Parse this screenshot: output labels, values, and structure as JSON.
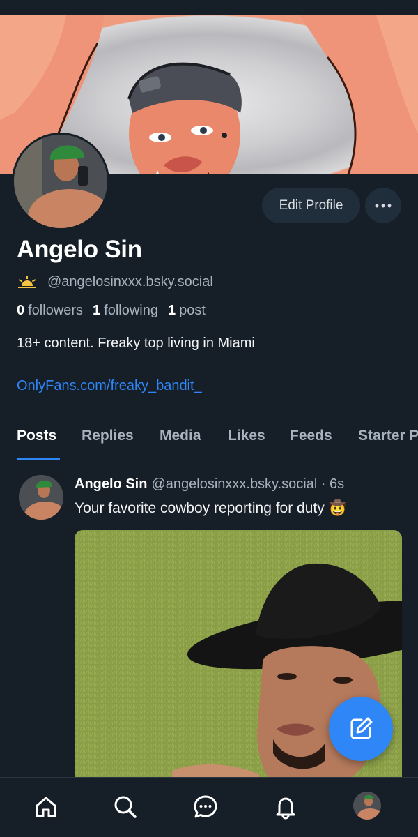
{
  "profile": {
    "display_name": "Angelo Sin",
    "handle": "@angelosinxxx.bsky.social",
    "handle_icon": "sunrise-icon",
    "stats": {
      "followers_count": "0",
      "followers_label": "followers",
      "following_count": "1",
      "following_label": "following",
      "posts_count": "1",
      "posts_label": "post"
    },
    "bio": "18+ content. Freaky top living in Miami",
    "link": "OnlyFans.com/freaky_bandit_"
  },
  "actions": {
    "edit_profile_label": "Edit Profile",
    "more_icon": "ellipsis-icon"
  },
  "tabs": [
    {
      "label": "Posts",
      "active": true
    },
    {
      "label": "Replies",
      "active": false
    },
    {
      "label": "Media",
      "active": false
    },
    {
      "label": "Likes",
      "active": false
    },
    {
      "label": "Feeds",
      "active": false
    },
    {
      "label": "Starter Packs",
      "active": false
    }
  ],
  "post": {
    "author": "Angelo Sin",
    "handle": "@angelosinxxx.bsky.social",
    "separator": " · ",
    "time": "6s",
    "text": "Your favorite cowboy reporting for duty 🤠"
  },
  "fab": {
    "icon": "compose-icon"
  },
  "bottom_nav": [
    {
      "name": "home-icon"
    },
    {
      "name": "search-icon"
    },
    {
      "name": "chat-icon"
    },
    {
      "name": "notifications-icon"
    },
    {
      "name": "profile-avatar"
    }
  ],
  "colors": {
    "background": "#161e27",
    "accent": "#2f86f6",
    "secondary_text": "#a8b3bf",
    "button_bg": "#202d3a"
  }
}
